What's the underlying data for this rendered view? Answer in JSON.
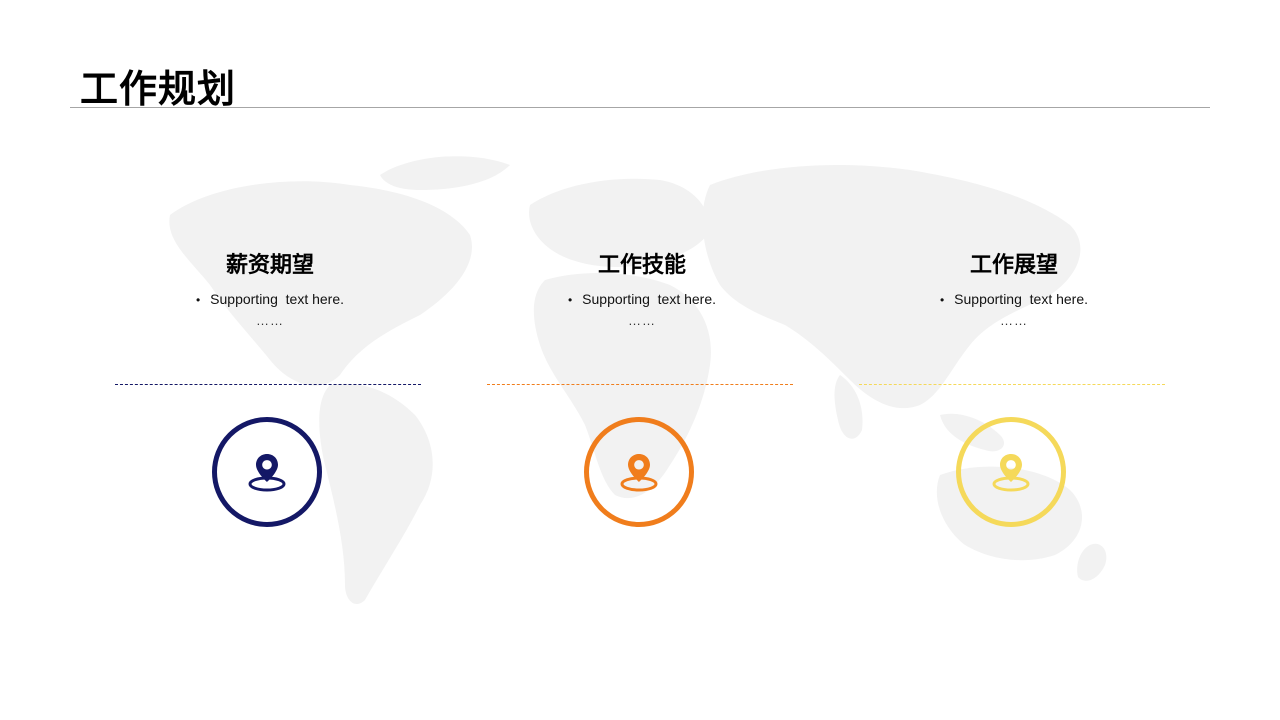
{
  "title": "工作规划",
  "columns": [
    {
      "heading": "薪资期望",
      "bullet": "Supporting  text here.",
      "ellipsis": "……",
      "accent": "#141866",
      "icon": "location-pin-icon"
    },
    {
      "heading": "工作技能",
      "bullet": "Supporting  text here.",
      "ellipsis": "……",
      "accent": "#f07d1c",
      "icon": "location-pin-icon"
    },
    {
      "heading": "工作展望",
      "bullet": "Supporting  text here.",
      "ellipsis": "……",
      "accent": "#f5d95a",
      "icon": "location-pin-icon"
    }
  ],
  "colors": {
    "map": "#f2f2f2",
    "rule": "#a6a6a6"
  }
}
